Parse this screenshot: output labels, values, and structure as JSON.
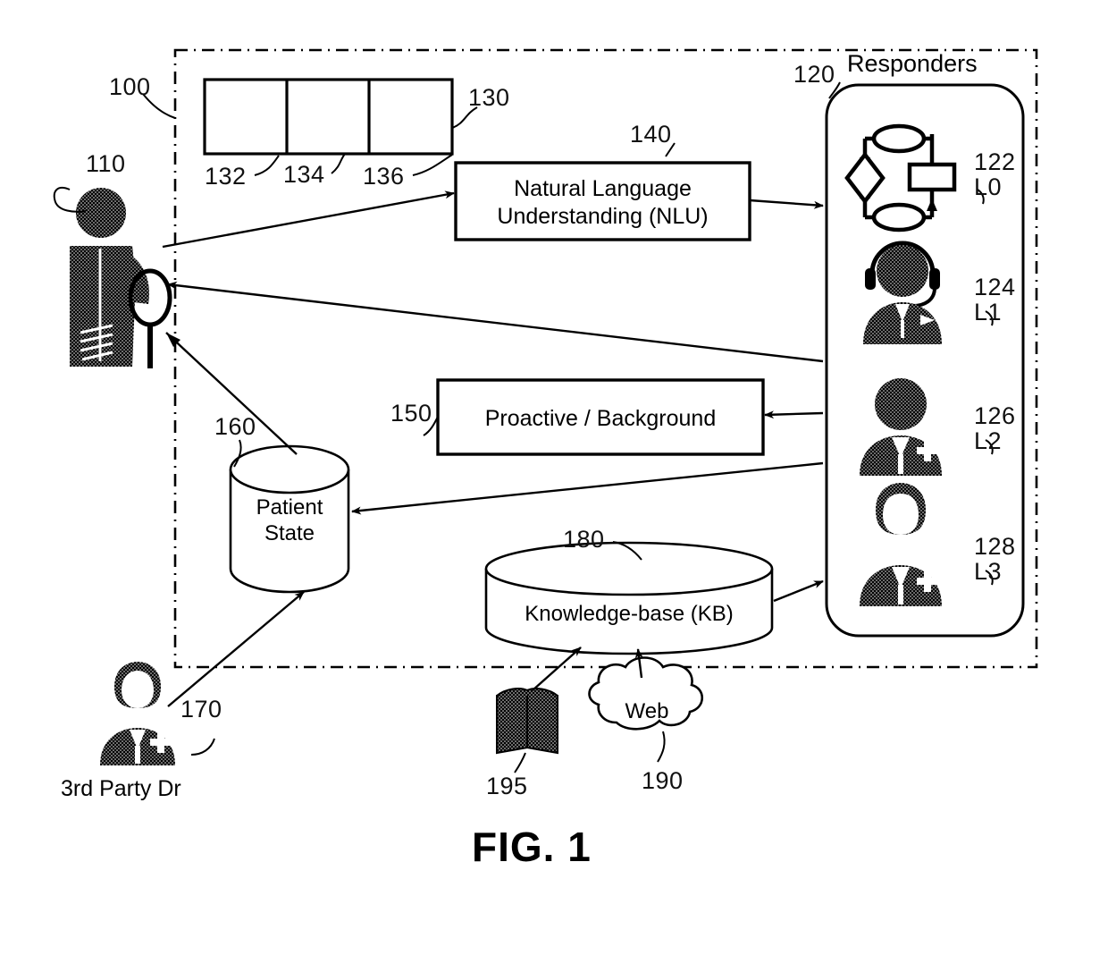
{
  "figure": {
    "caption": "FIG. 1",
    "system_ref": "100"
  },
  "system_boundary": {
    "ref": "100",
    "style": "dash-dot outline"
  },
  "actors": {
    "patient": {
      "ref": "110",
      "icon": "patient-with-racket-and-bandaged-leg-icon",
      "label": ""
    },
    "third_party_doctor": {
      "ref": "170",
      "label": "3rd Party Dr",
      "icon": "doctor-avatar-icon"
    }
  },
  "input_row": {
    "ref": "130",
    "cells": [
      {
        "ref": "132",
        "label": ""
      },
      {
        "ref": "134",
        "label": ""
      },
      {
        "ref": "136",
        "label": ""
      }
    ]
  },
  "modules": {
    "nlu": {
      "ref": "140",
      "label": "Natural Language\nUnderstanding (NLU)"
    },
    "proactive": {
      "ref": "150",
      "label": "Proactive / Background"
    }
  },
  "datastores": {
    "patient_state": {
      "ref": "160",
      "label": "Patient\nState",
      "icon": "cylinder-database-icon"
    },
    "knowledge_base": {
      "ref": "180",
      "label": "Knowledge-base (KB)",
      "icon": "cylinder-database-icon"
    }
  },
  "external_sources": {
    "book": {
      "ref": "195",
      "label": "",
      "icon": "open-book-icon"
    },
    "web": {
      "ref": "190",
      "label": "Web",
      "icon": "cloud-icon"
    }
  },
  "responders": {
    "title": "Responders",
    "ref": "120",
    "items": [
      {
        "ref": "122",
        "level": "L0",
        "icon": "flowchart-automation-icon"
      },
      {
        "ref": "124",
        "level": "L1",
        "icon": "headset-agent-icon"
      },
      {
        "ref": "126",
        "level": "L2",
        "icon": "nurse-avatar-icon"
      },
      {
        "ref": "128",
        "level": "L3",
        "icon": "doctor-avatar-icon"
      }
    ]
  },
  "colors": {
    "ink": "#000000",
    "paper": "#ffffff"
  }
}
